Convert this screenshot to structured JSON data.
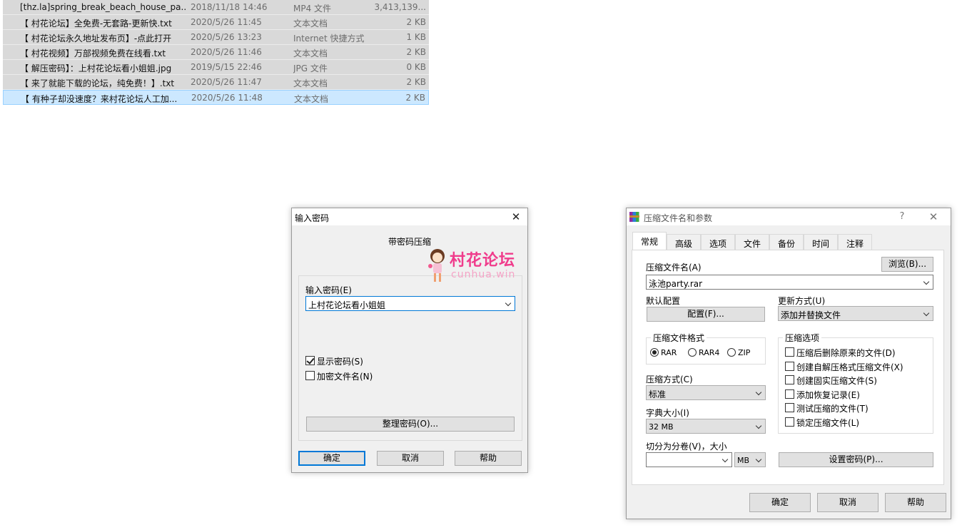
{
  "files": [
    {
      "name": "[thz.la]spring_break_beach_house_pa...",
      "date": "2018/11/18 14:46",
      "type": "MP4 文件",
      "size": "3,413,139...",
      "icon": "video-file-icon",
      "selected": false
    },
    {
      "name": "【 村花论坛】全免费-无套路-更新快.txt",
      "date": "2020/5/26 11:45",
      "type": "文本文档",
      "size": "2 KB",
      "icon": "text-file-icon",
      "selected": false
    },
    {
      "name": "【 村花论坛永久地址发布页】-点此打开",
      "date": "2020/5/26 13:23",
      "type": "Internet 快捷方式",
      "size": "1 KB",
      "icon": "edge-shortcut-icon",
      "selected": false
    },
    {
      "name": "【 村花视频】万部视频免费在线看.txt",
      "date": "2020/5/26 11:46",
      "type": "文本文档",
      "size": "2 KB",
      "icon": "text-file-icon",
      "selected": false
    },
    {
      "name": "【 解压密码】：上村花论坛看小姐姐.jpg",
      "date": "2019/5/15 22:46",
      "type": "JPG 文件",
      "size": "0 KB",
      "icon": "image-file-icon",
      "selected": false
    },
    {
      "name": "【 来了就能下载的论坛，纯免费！】.txt",
      "date": "2020/5/26 11:47",
      "type": "文本文档",
      "size": "2 KB",
      "icon": "text-file-icon",
      "selected": false
    },
    {
      "name": "【 有种子却没速度？来村花论坛人工加...",
      "date": "2020/5/26 11:48",
      "type": "文本文档",
      "size": "2 KB",
      "icon": "text-file-icon",
      "selected": true
    }
  ],
  "password_dialog": {
    "title": "输入密码",
    "heading": "带密码压缩",
    "password_label": "输入密码(E)",
    "password_value": "上村花论坛看小姐姐",
    "show_password_label": "显示密码(S)",
    "show_password_checked": true,
    "encrypt_names_label": "加密文件名(N)",
    "encrypt_names_checked": false,
    "organize_button": "整理密码(O)...",
    "ok_button": "确定",
    "cancel_button": "取消",
    "help_button": "帮助"
  },
  "watermark": {
    "text": "村花论坛",
    "sub": "cunhua.win"
  },
  "archive_dialog": {
    "title": "压缩文件名和参数",
    "help_glyph": "?",
    "tabs": [
      "常规",
      "高级",
      "选项",
      "文件",
      "备份",
      "时间",
      "注释"
    ],
    "active_tab": "常规",
    "archive_name_label": "压缩文件名(A)",
    "browse_button": "浏览(B)...",
    "archive_name_value": "泳池party.rar",
    "default_profile_label": "默认配置",
    "profiles_button": "配置(F)...",
    "update_mode_label": "更新方式(U)",
    "update_mode_value": "添加并替换文件",
    "format_group_label": "压缩文件格式",
    "formats": [
      {
        "label": "RAR",
        "checked": true
      },
      {
        "label": "RAR4",
        "checked": false
      },
      {
        "label": "ZIP",
        "checked": false
      }
    ],
    "method_label": "压缩方式(C)",
    "method_value": "标准",
    "dict_label": "字典大小(I)",
    "dict_value": "32 MB",
    "split_label": "切分为分卷(V)，大小",
    "split_value": "",
    "split_unit": "MB",
    "options_group_label": "压缩选项",
    "options": [
      {
        "label": "压缩后删除原来的文件(D)",
        "checked": false
      },
      {
        "label": "创建自解压格式压缩文件(X)",
        "checked": false
      },
      {
        "label": "创建固实压缩文件(S)",
        "checked": false
      },
      {
        "label": "添加恢复记录(E)",
        "checked": false
      },
      {
        "label": "测试压缩的文件(T)",
        "checked": false
      },
      {
        "label": "锁定压缩文件(L)",
        "checked": false
      }
    ],
    "set_password_button": "设置密码(P)...",
    "ok_button": "确定",
    "cancel_button": "取消",
    "help_button": "帮助"
  }
}
